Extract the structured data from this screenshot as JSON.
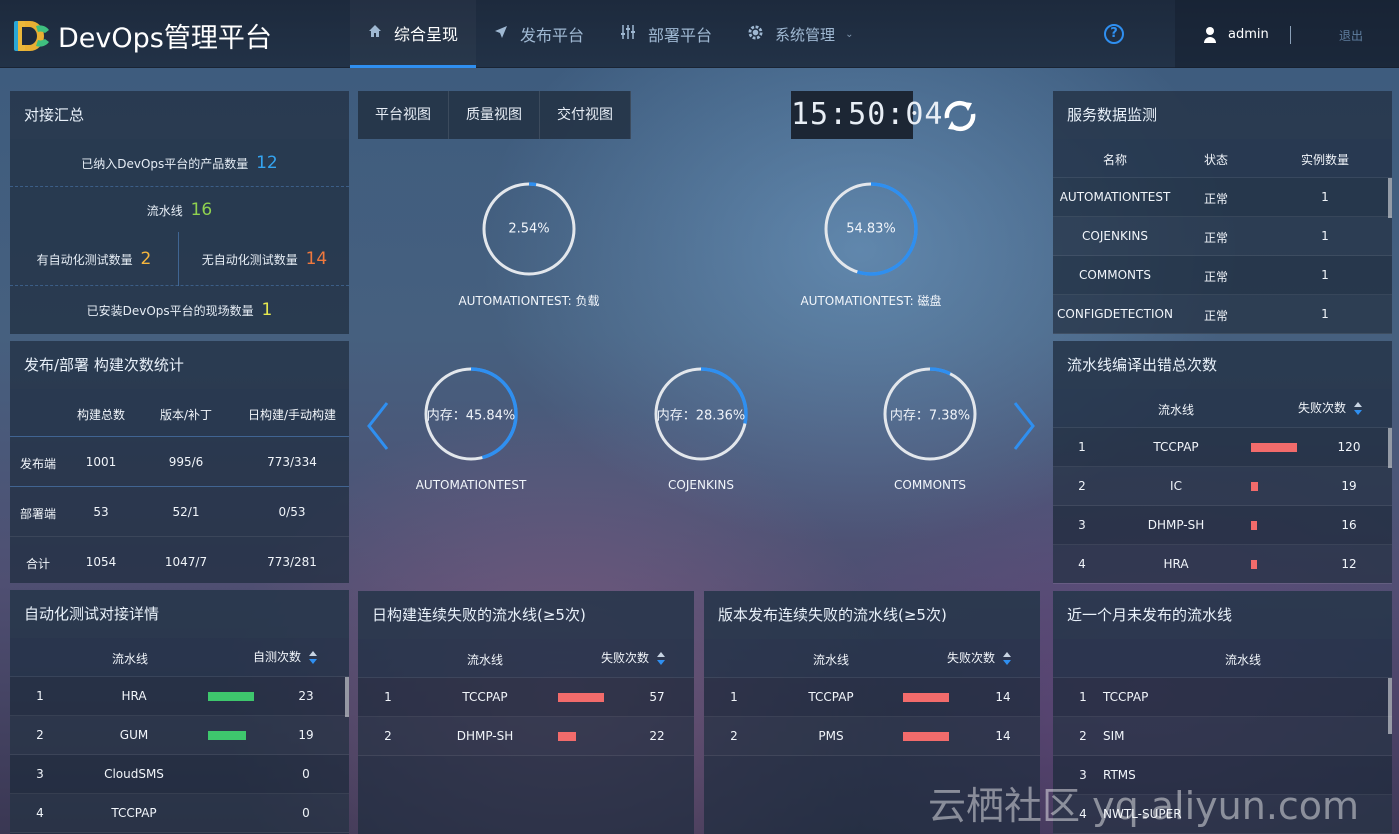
{
  "header": {
    "brand": "DevOps管理平台",
    "nav": [
      {
        "label": "综合呈现",
        "icon": "home-icon",
        "active": true
      },
      {
        "label": "发布平台",
        "icon": "send-icon",
        "active": false
      },
      {
        "label": "部署平台",
        "icon": "sliders-icon",
        "active": false
      },
      {
        "label": "系统管理",
        "icon": "gear-icon",
        "active": false
      }
    ],
    "help_icon": "?",
    "user": "admin",
    "logout": "退出",
    "accent": "#2f8ff0"
  },
  "summary": {
    "title": "对接汇总",
    "product_label": "已纳入DevOps平台的产品数量",
    "product_count": "12",
    "pipeline_label": "流水线",
    "pipeline_count": "16",
    "auto_label": "有自动化测试数量",
    "auto_count": "2",
    "noauto_label": "无自动化测试数量",
    "noauto_count": "14",
    "site_label": "已安装DevOps平台的现场数量",
    "site_count": "1"
  },
  "build_stats": {
    "title": "发布/部署 构建次数统计",
    "headers": [
      "",
      "构建总数",
      "版本/补丁",
      "日构建/手动构建"
    ],
    "rows": [
      [
        "发布端",
        "1001",
        "995/6",
        "773/334"
      ],
      [
        "部署端",
        "53",
        "52/1",
        "0/53"
      ],
      [
        "合计",
        "1054",
        "1047/7",
        "773/281"
      ]
    ]
  },
  "autotest": {
    "title": "自动化测试对接详情",
    "col_pipeline": "流水线",
    "col_count": "自测次数",
    "bar_color": "#3ec76d",
    "rows": [
      {
        "idx": "1",
        "name": "HRA",
        "value": 23
      },
      {
        "idx": "2",
        "name": "GUM",
        "value": 19
      },
      {
        "idx": "3",
        "name": "CloudSMS",
        "value": 0
      },
      {
        "idx": "4",
        "name": "TCCPAP",
        "value": 0
      }
    ]
  },
  "view_tabs": [
    "平台视图",
    "质量视图",
    "交付视图"
  ],
  "clock": "15:50:04",
  "gauges": [
    {
      "value": "2.54%",
      "fraction": 0.0254,
      "label": "AUTOMATIONTEST: 负载"
    },
    {
      "value": "54.83%",
      "fraction": 0.5483,
      "label": "AUTOMATIONTEST: 磁盘"
    },
    {
      "value": "内存：45.84%",
      "fraction": 0.4584,
      "label": "AUTOMATIONTEST"
    },
    {
      "value": "内存：28.36%",
      "fraction": 0.2836,
      "label": "COJENKINS"
    },
    {
      "value": "内存：7.38%",
      "fraction": 0.0738,
      "label": "COMMONTS"
    }
  ],
  "daily_fail": {
    "title": "日构建连续失败的流水线(≥5次)",
    "col_pipeline": "流水线",
    "col_count": "失败次数",
    "bar_color": "#f26b6b",
    "rows": [
      {
        "idx": "1",
        "name": "TCCPAP",
        "value": 57
      },
      {
        "idx": "2",
        "name": "DHMP-SH",
        "value": 22
      }
    ]
  },
  "release_fail": {
    "title": "版本发布连续失败的流水线(≥5次)",
    "col_pipeline": "流水线",
    "col_count": "失败次数",
    "bar_color": "#f26b6b",
    "rows": [
      {
        "idx": "1",
        "name": "TCCPAP",
        "value": 14
      },
      {
        "idx": "2",
        "name": "PMS",
        "value": 14
      }
    ]
  },
  "service_monitor": {
    "title": "服务数据监测",
    "headers": [
      "名称",
      "状态",
      "实例数量"
    ],
    "rows": [
      [
        "AUTOMATIONTEST",
        "正常",
        "1"
      ],
      [
        "COJENKINS",
        "正常",
        "1"
      ],
      [
        "COMMONTS",
        "正常",
        "1"
      ],
      [
        "CONFIGDETECTION",
        "正常",
        "1"
      ]
    ]
  },
  "compile_errors": {
    "title": "流水线编译出错总次数",
    "col_pipeline": "流水线",
    "col_count": "失败次数",
    "bar_color": "#f26b6b",
    "rows": [
      {
        "idx": "1",
        "name": "TCCPAP",
        "value": 120
      },
      {
        "idx": "2",
        "name": "IC",
        "value": 19
      },
      {
        "idx": "3",
        "name": "DHMP-SH",
        "value": 16
      },
      {
        "idx": "4",
        "name": "HRA",
        "value": 12
      }
    ]
  },
  "unreleased": {
    "title": "近一个月未发布的流水线",
    "col_pipeline": "流水线",
    "rows": [
      {
        "idx": "1",
        "name": "TCCPAP"
      },
      {
        "idx": "2",
        "name": "SIM"
      },
      {
        "idx": "3",
        "name": "RTMS"
      },
      {
        "idx": "4",
        "name": "NWTL-SUPER"
      }
    ]
  },
  "watermark": "云栖社区 yq.aliyun.com"
}
